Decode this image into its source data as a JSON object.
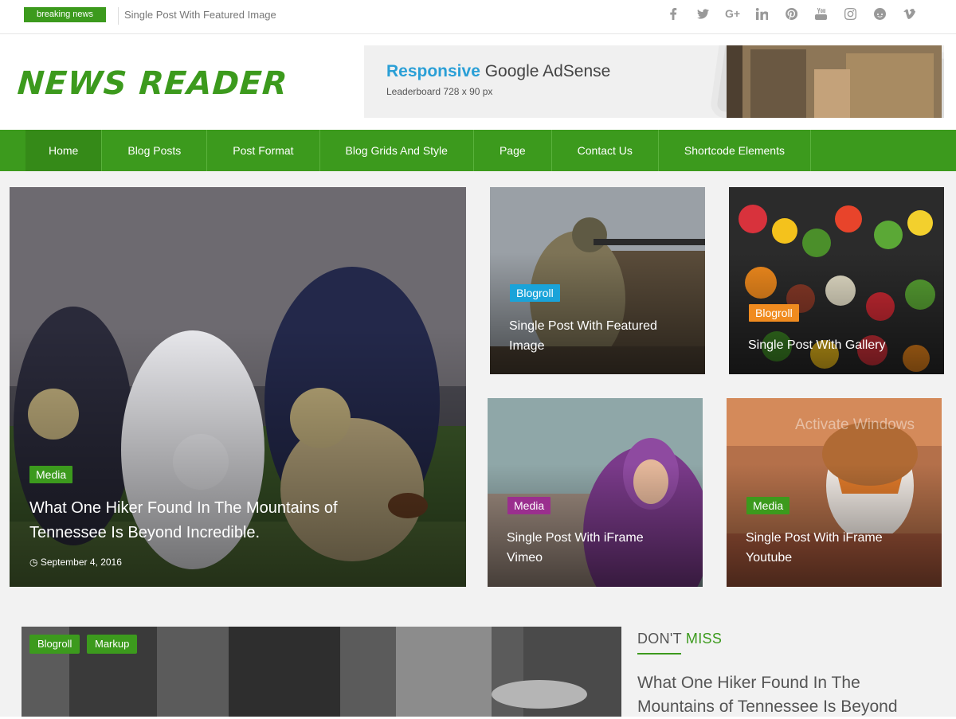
{
  "topbar": {
    "breaking_label": "breaking news",
    "ticker_text": "Single Post With Featured Image",
    "socials": [
      "facebook-icon",
      "twitter-icon",
      "google-plus-icon",
      "linkedin-icon",
      "pinterest-icon",
      "youtube-icon",
      "instagram-icon",
      "reddit-icon",
      "vimeo-icon"
    ]
  },
  "header": {
    "logo": "NEWS READER",
    "ad": {
      "accent": "Responsive",
      "title_rest": " Google AdSense",
      "subtitle": "Leaderboard 728 x 90 px"
    }
  },
  "nav": {
    "items": [
      {
        "label": "Home"
      },
      {
        "label": "Blog Posts"
      },
      {
        "label": "Post Format"
      },
      {
        "label": "Blog Grids And Style"
      },
      {
        "label": "Page"
      },
      {
        "label": "Contact Us"
      },
      {
        "label": "Shortcode Elements"
      }
    ]
  },
  "featured": {
    "main": {
      "category": "Media",
      "title": "What One Hiker Found In The Mountains of Tennessee Is Beyond Incredible.",
      "date": "September 4, 2016"
    },
    "cards": [
      {
        "category": "Blogroll",
        "title": "Single Post With Featured Image",
        "color": "#1aa3d9"
      },
      {
        "category": "Blogroll",
        "title": "Single Post With Gallery",
        "color": "#f08b1f"
      },
      {
        "category": "Media",
        "title": "Single Post With iFrame Vimeo",
        "color": "#9a2f8e"
      },
      {
        "category": "Media",
        "title": "Single Post With iFrame Youtube",
        "color": "#3c9a1d"
      }
    ]
  },
  "lower": {
    "tags": [
      "Blogroll",
      "Markup"
    ],
    "dont_miss": {
      "word1": "DON'T",
      "word2": "MISS"
    },
    "dont_miss_title": "What One Hiker Found In The Mountains of Tennessee Is Beyond"
  },
  "watermark": "Activate Windows",
  "colors": {
    "brand_green": "#3c9a1d",
    "nav_active": "#358a18"
  }
}
